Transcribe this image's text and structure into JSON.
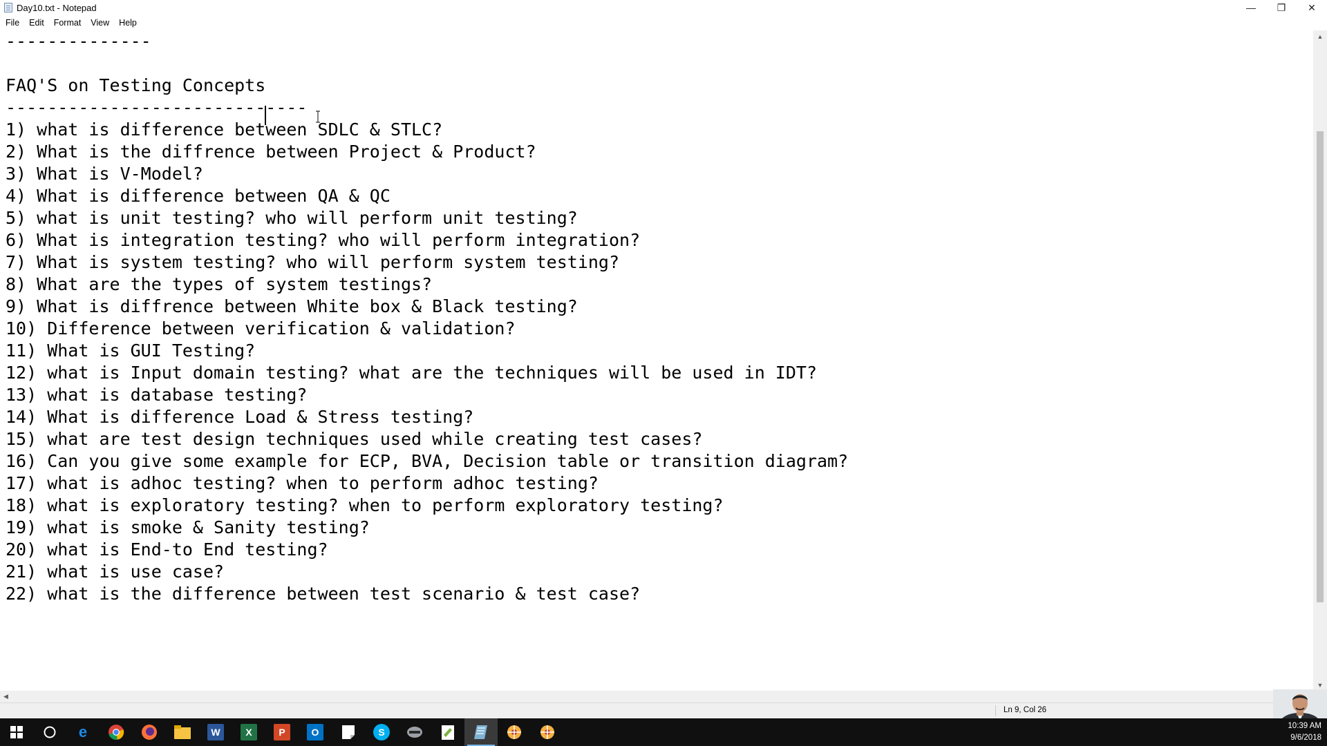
{
  "window": {
    "title": "Day10.txt - Notepad",
    "controls": {
      "minimize": "—",
      "restore": "❐",
      "close": "✕"
    }
  },
  "menu": [
    {
      "label": "File"
    },
    {
      "label": "Edit"
    },
    {
      "label": "Format"
    },
    {
      "label": "View"
    },
    {
      "label": "Help"
    }
  ],
  "editor": {
    "content": "--------------\n\nFAQ'S on Testing Concepts\n-----------------------------\n1) what is difference between SDLC & STLC?\n2) What is the diffrence between Project & Product?\n3) What is V-Model?\n4) What is difference between QA & QC\n5) what is unit testing? who will perform unit testing?\n6) What is integration testing? who will perform integration?\n7) What is system testing? who will perform system testing?\n8) What are the types of system testings?\n9) What is diffrence between White box & Black testing?\n10) Difference between verification & validation?\n11) What is GUI Testing?\n12) what is Input domain testing? what are the techniques will be used in IDT?\n13) what is database testing?\n14) What is difference Load & Stress testing?\n15) what are test design techniques used while creating test cases?\n16) Can you give some example for ECP, BVA, Decision table or transition diagram?\n17) what is adhoc testing? when to perform adhoc testing?\n18) what is exploratory testing? when to perform exploratory testing?\n19) what is smoke & Sanity testing?\n20) what is End-to End testing?\n21) what is use case?\n22) what is the difference between test scenario & test case?"
  },
  "scrollbars": {
    "up": "▲",
    "down": "▼",
    "left": "◀",
    "right": "▶"
  },
  "status": {
    "position": "Ln 9, Col 26"
  },
  "taskbar": {
    "apps": [
      {
        "icon": "windows-start-icon",
        "color": "#ffffff"
      },
      {
        "icon": "cortana-search-icon",
        "color": "#ffffff"
      },
      {
        "icon": "edge-browser-icon",
        "color": "#1e88e5",
        "glyph": "e"
      },
      {
        "icon": "chrome-browser-icon",
        "color": "#4caf50"
      },
      {
        "icon": "firefox-browser-icon",
        "color": "#ff7139"
      },
      {
        "icon": "file-explorer-icon",
        "color": "#f6c343"
      },
      {
        "icon": "word-icon",
        "color": "#2b579a",
        "glyph": "W"
      },
      {
        "icon": "excel-icon",
        "color": "#217346",
        "glyph": "X"
      },
      {
        "icon": "powerpoint-icon",
        "color": "#d24726",
        "glyph": "P"
      },
      {
        "icon": "outlook-icon",
        "color": "#0072c6",
        "glyph": "O"
      },
      {
        "icon": "sticky-notes-icon",
        "color": "#ffffff"
      },
      {
        "icon": "skype-icon",
        "color": "#00aff0",
        "glyph": "S"
      },
      {
        "icon": "terminal-app-icon",
        "color": "#9aa0a6"
      },
      {
        "icon": "notepad-plus-icon",
        "color": "#7cb342"
      },
      {
        "icon": "notepad-icon",
        "color": "#7fb3d5"
      },
      {
        "icon": "app-cog-icon-1",
        "color": "#f5b041"
      },
      {
        "icon": "app-cog-icon-2",
        "color": "#f5b041"
      }
    ],
    "clock": {
      "time": "10:39 AM",
      "date": "9/6/2018"
    }
  }
}
